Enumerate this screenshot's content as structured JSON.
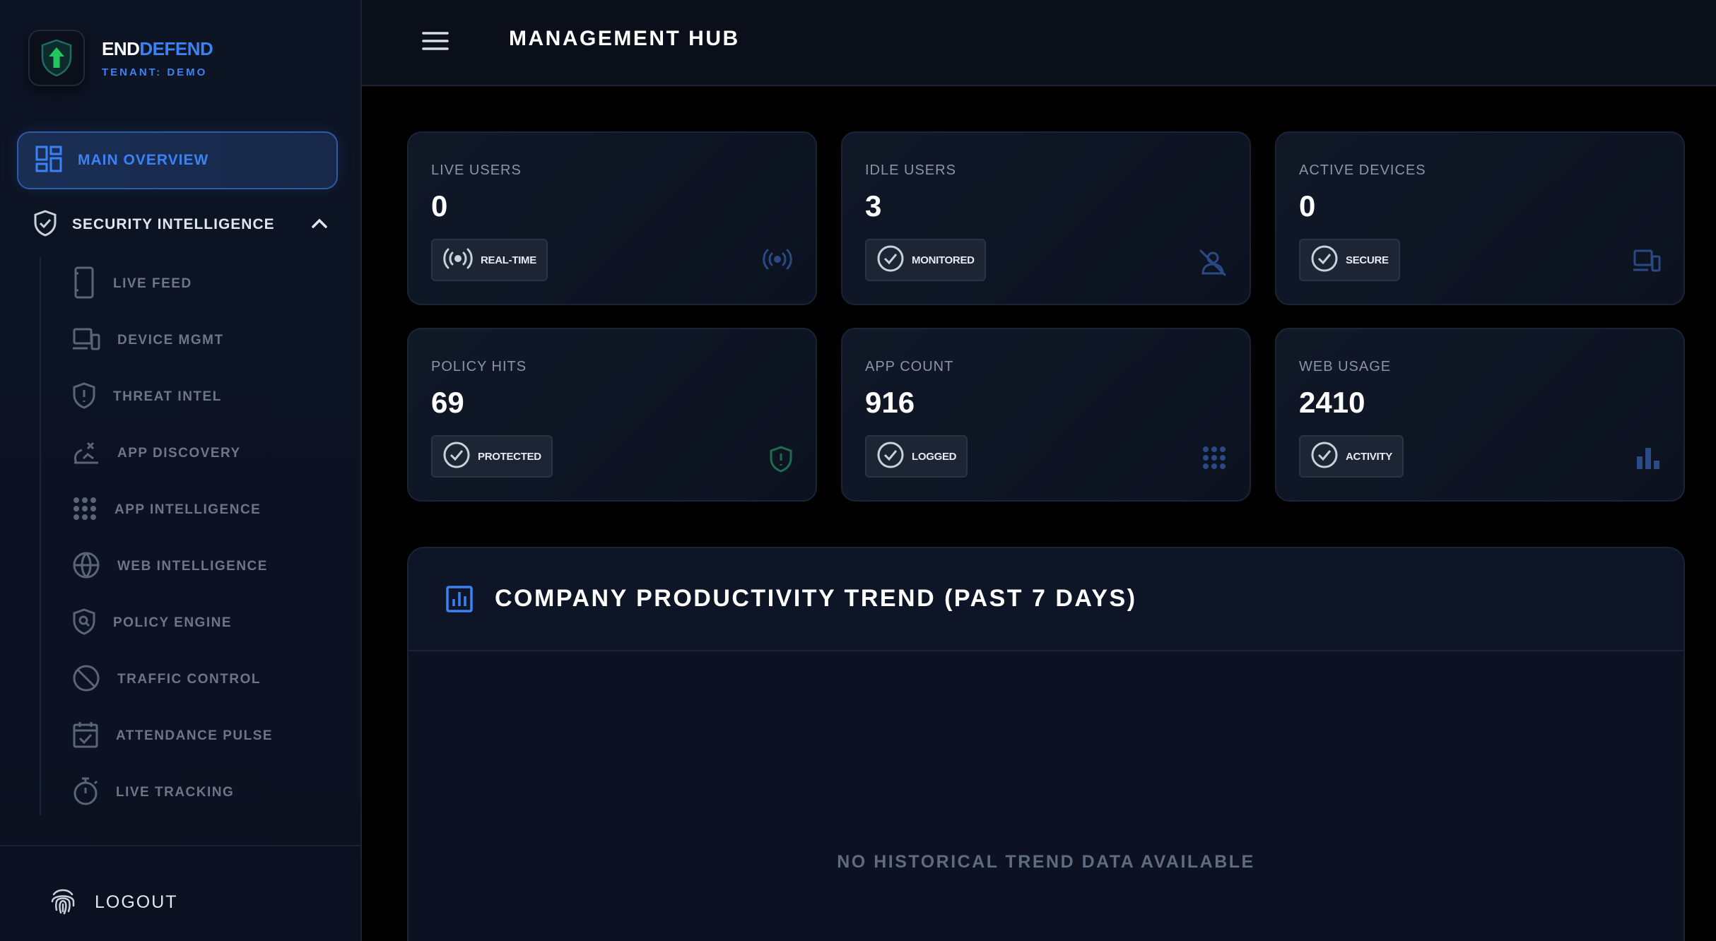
{
  "brand": {
    "name_part1": "END",
    "name_part2": "DEFEND",
    "tenant": "TENANT: DEMO"
  },
  "sidebar": {
    "main": {
      "label": "MAIN OVERVIEW",
      "icon": "dashboard-icon"
    },
    "group": {
      "label": "SECURITY INTELLIGENCE",
      "icon": "shield-check-icon",
      "expanded": true
    },
    "items": [
      {
        "label": "LIVE FEED",
        "icon": "phone-icon"
      },
      {
        "label": "DEVICE MGMT",
        "icon": "devices-icon"
      },
      {
        "label": "THREAT INTEL",
        "icon": "shield-alert-icon"
      },
      {
        "label": "APP DISCOVERY",
        "icon": "app-discovery-icon"
      },
      {
        "label": "APP INTELLIGENCE",
        "icon": "grid-dots-icon"
      },
      {
        "label": "WEB INTELLIGENCE",
        "icon": "globe-icon"
      },
      {
        "label": "POLICY ENGINE",
        "icon": "shield-search-icon"
      },
      {
        "label": "TRAFFIC CONTROL",
        "icon": "block-icon"
      },
      {
        "label": "ATTENDANCE PULSE",
        "icon": "calendar-check-icon"
      },
      {
        "label": "LIVE TRACKING",
        "icon": "stopwatch-icon"
      }
    ],
    "logout": {
      "label": "LOGOUT",
      "icon": "fingerprint-icon"
    }
  },
  "header": {
    "title": "MANAGEMENT HUB",
    "menu_icon": "hamburger-icon"
  },
  "stats": [
    {
      "title": "LIVE USERS",
      "value": "0",
      "badge": "REAL-TIME",
      "badge_icon": "broadcast-icon",
      "corner_icon": "broadcast-icon",
      "corner_color": "#2b4a85"
    },
    {
      "title": "IDLE USERS",
      "value": "3",
      "badge": "MONITORED",
      "badge_icon": "check-circle-icon",
      "corner_icon": "user-off-icon",
      "corner_color": "#2b4a85"
    },
    {
      "title": "ACTIVE DEVICES",
      "value": "0",
      "badge": "SECURE",
      "badge_icon": "check-circle-icon",
      "corner_icon": "devices-icon",
      "corner_color": "#2b4a85"
    },
    {
      "title": "POLICY HITS",
      "value": "69",
      "badge": "PROTECTED",
      "badge_icon": "check-circle-icon",
      "corner_icon": "shield-alert-icon",
      "corner_color": "#1f6b52"
    },
    {
      "title": "APP COUNT",
      "value": "916",
      "badge": "LOGGED",
      "badge_icon": "check-circle-icon",
      "corner_icon": "grid-dots-icon",
      "corner_color": "#2b4a85"
    },
    {
      "title": "WEB USAGE",
      "value": "2410",
      "badge": "ACTIVITY",
      "badge_icon": "check-circle-icon",
      "corner_icon": "bar-chart-icon",
      "corner_color": "#2b4a85"
    }
  ],
  "trend": {
    "title": "COMPANY PRODUCTIVITY TREND (PAST 7 DAYS)",
    "icon": "chart-box-icon",
    "empty_message": "NO HISTORICAL TREND DATA AVAILABLE"
  },
  "colors": {
    "accent": "#3b82f6",
    "success": "#22c55e",
    "muted": "#6b7689"
  }
}
